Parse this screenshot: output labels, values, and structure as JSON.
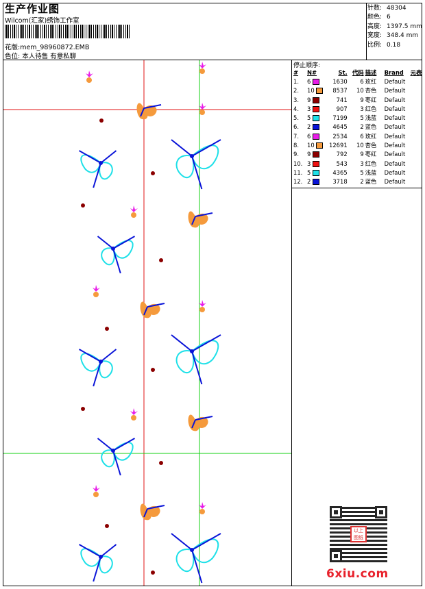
{
  "header": {
    "title": "生产作业图",
    "studio": "Wilcom(汇家)绣饰工作室",
    "pattern_label": "花版:",
    "pattern_file": "mem_98960872.EMB",
    "color_label": "色位:",
    "color_note": "本人待售 有意私聊"
  },
  "stats": [
    {
      "k": "针数:",
      "v": "48304"
    },
    {
      "k": "颜色:",
      "v": "6"
    },
    {
      "k": "高度:",
      "v": "1397.5 mm"
    },
    {
      "k": "宽度:",
      "v": "348.4 mm"
    },
    {
      "k": "比例:",
      "v": "0.18"
    }
  ],
  "stop_sequence": {
    "label": "停止顺序:",
    "headers": [
      "#",
      "N#",
      "St.",
      "代码",
      "描述",
      "Brand",
      "元表"
    ],
    "rows": [
      {
        "i": "1.",
        "n": "6",
        "st": "1630",
        "code": "6",
        "desc": "玫红",
        "brand": "Default",
        "color": "#e81ee8"
      },
      {
        "i": "2.",
        "n": "10",
        "st": "8537",
        "code": "10",
        "desc": "杏色",
        "brand": "Default",
        "color": "#f59a3c"
      },
      {
        "i": "3.",
        "n": "9",
        "st": "741",
        "code": "9",
        "desc": "枣红",
        "brand": "Default",
        "color": "#8b0000"
      },
      {
        "i": "4.",
        "n": "3",
        "st": "907",
        "code": "3",
        "desc": "红色",
        "brand": "Default",
        "color": "#ee1111"
      },
      {
        "i": "5.",
        "n": "5",
        "st": "7199",
        "code": "5",
        "desc": "浅蓝",
        "brand": "Default",
        "color": "#1ee0e8"
      },
      {
        "i": "6.",
        "n": "2",
        "st": "4645",
        "code": "2",
        "desc": "蓝色",
        "brand": "Default",
        "color": "#0a14d8"
      },
      {
        "i": "7.",
        "n": "6",
        "st": "2534",
        "code": "6",
        "desc": "玫红",
        "brand": "Default",
        "color": "#e81ee8"
      },
      {
        "i": "8.",
        "n": "10",
        "st": "12691",
        "code": "10",
        "desc": "杏色",
        "brand": "Default",
        "color": "#f59a3c"
      },
      {
        "i": "9.",
        "n": "9",
        "st": "792",
        "code": "9",
        "desc": "枣红",
        "brand": "Default",
        "color": "#8b0000"
      },
      {
        "i": "10.",
        "n": "3",
        "st": "543",
        "code": "3",
        "desc": "红色",
        "brand": "Default",
        "color": "#ee1111"
      },
      {
        "i": "11.",
        "n": "5",
        "st": "4365",
        "code": "5",
        "desc": "浅蓝",
        "brand": "Default",
        "color": "#1ee0e8"
      },
      {
        "i": "12.",
        "n": "2",
        "st": "3718",
        "code": "2",
        "desc": "蓝色",
        "brand": "Default",
        "color": "#0a14d8"
      }
    ]
  },
  "watermark": "6xiu.com",
  "seal_text": "以上图纸",
  "colors": {
    "guide_red": "#e01010",
    "guide_green": "#10d010",
    "orange": "#f59a3c",
    "cyan": "#1ee0e8",
    "blue": "#0a14d8",
    "magenta": "#e81ee8"
  }
}
